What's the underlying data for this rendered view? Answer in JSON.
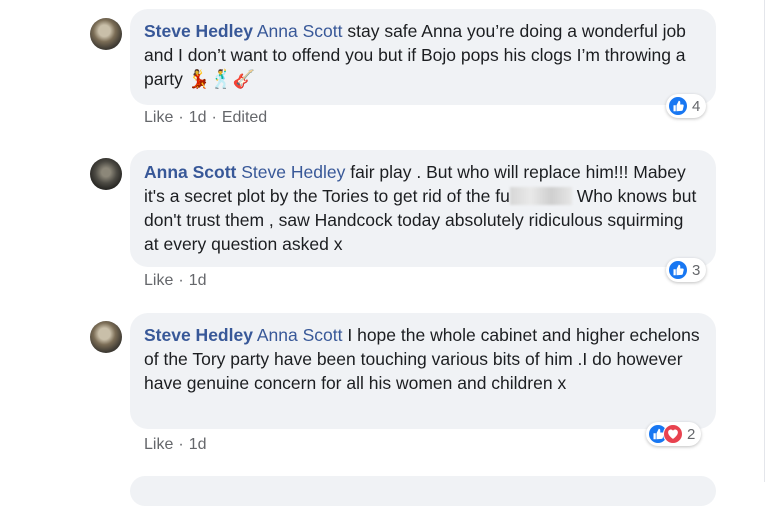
{
  "comments": [
    {
      "author": "Steve Hedley",
      "mention": "Anna Scott",
      "text": "stay safe Anna you’re doing a wonderful job and I don’t want to offend you but if Bojo pops his clogs I’m throwing a party",
      "emojis": [
        "💃",
        "🕺",
        "🎸"
      ],
      "emoji_names": [
        "dancer-emoji",
        "man-dancing-emoji",
        "guitar-emoji"
      ],
      "actions": {
        "like": "Like",
        "time": "1d",
        "edited": "Edited"
      },
      "reaction_count": "4",
      "reactions": [
        "like"
      ]
    },
    {
      "author": "Anna Scott",
      "mention": "Steve Hedley",
      "text_before": "fair play . But who will replace him!!! Mabey it's a secret plot by the Tories to get rid of the fu",
      "text_after": "Who knows but don't trust them , saw Handcock today absolutely ridiculous squirming at every question asked x",
      "actions": {
        "like": "Like",
        "time": "1d"
      },
      "reaction_count": "3",
      "reactions": [
        "like"
      ]
    },
    {
      "author": "Steve Hedley",
      "mention": "Anna Scott",
      "text": "I hope the whole cabinet and higher echelons of the Tory party have been touching various bits of him .I do however have genuine concern for all his women and children x",
      "actions": {
        "like": "Like",
        "time": "1d"
      },
      "reaction_count": "2",
      "reactions": [
        "like",
        "love"
      ]
    }
  ],
  "colors": {
    "name_link": "#385898",
    "bubble_bg": "#f0f2f5",
    "meta": "#65676b",
    "like_blue": "#1877f2",
    "love_red": "#e8424f"
  }
}
